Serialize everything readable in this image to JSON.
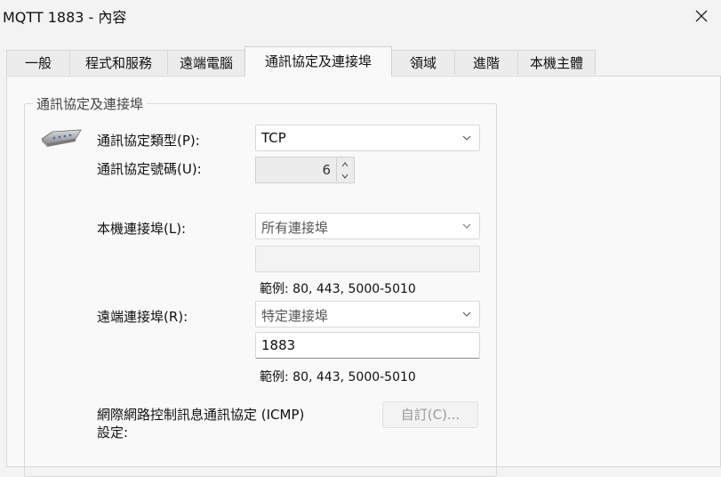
{
  "window": {
    "title": "MQTT 1883 - 內容"
  },
  "tabs": [
    {
      "label": "一般"
    },
    {
      "label": "程式和服務"
    },
    {
      "label": "遠端電腦"
    },
    {
      "label": "通訊協定及連接埠"
    },
    {
      "label": "領域"
    },
    {
      "label": "進階"
    },
    {
      "label": "本機主體"
    }
  ],
  "active_tab_index": 3,
  "group": {
    "title": "通訊協定及連接埠",
    "protocol_type": {
      "label": "通訊協定類型(P):",
      "value": "TCP"
    },
    "protocol_number": {
      "label": "通訊協定號碼(U):",
      "value": "6"
    },
    "local_port": {
      "label": "本機連接埠(L):",
      "value": "所有連接埠",
      "input_value": "",
      "hint": "範例: 80, 443, 5000-5010"
    },
    "remote_port": {
      "label": "遠端連接埠(R):",
      "value": "特定連接埠",
      "input_value": "1883",
      "hint": "範例: 80, 443, 5000-5010"
    },
    "icmp": {
      "label_line1": "網際網路控制訊息通訊協定 (ICMP)",
      "label_line2": "設定:",
      "button_label": "自訂(C)..."
    }
  },
  "icons": [
    "close-icon",
    "network-protocol-icon",
    "chevron-down-icon",
    "spin-up-icon",
    "spin-down-icon"
  ]
}
